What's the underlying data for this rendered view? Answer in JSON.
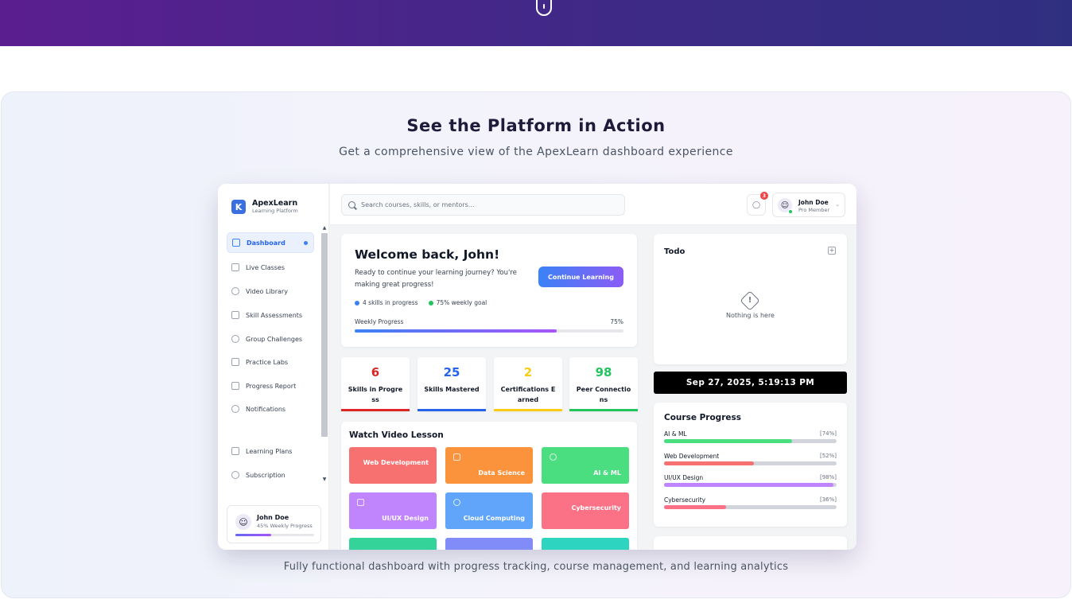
{
  "section": {
    "title": "See the Platform in Action",
    "subtitle": "Get a comprehensive view of the ApexLearn dashboard experience",
    "caption": "Fully functional dashboard with progress tracking, course management, and learning analytics"
  },
  "brand": {
    "logo": "K",
    "name": "ApexLearn",
    "tagline": "Learning Platform"
  },
  "sidebar": {
    "items": [
      {
        "label": "Dashboard",
        "icon": "home-icon",
        "active": true
      },
      {
        "label": "Live Classes",
        "icon": "video-icon"
      },
      {
        "label": "Video Library",
        "icon": "play-icon"
      },
      {
        "label": "Skill Assessments",
        "icon": "clipboard-icon"
      },
      {
        "label": "Group Challenges",
        "icon": "trophy-icon"
      },
      {
        "label": "Practice Labs",
        "icon": "lab-icon"
      },
      {
        "label": "Progress Report",
        "icon": "chart-icon"
      },
      {
        "label": "Notifications",
        "icon": "bell-icon"
      },
      {
        "label": "Learning Plans",
        "icon": "cart-icon"
      },
      {
        "label": "Subscription",
        "icon": "user-plus-icon"
      }
    ],
    "user": {
      "name": "John Doe",
      "progress_text": "45% Weekly Progress",
      "progress": 0.45
    }
  },
  "topbar": {
    "search_placeholder": "Search courses, skills, or mentors...",
    "notification_count": "3",
    "user_name": "John Doe",
    "user_role": "Pro Member"
  },
  "welcome": {
    "title": "Welcome back, John!",
    "text": "Ready to continue your learning journey? You're making great progress!",
    "cta": "Continue Learning",
    "chip1": "4 skills in progress",
    "chip2": "75% weekly goal",
    "progress_label": "Weekly Progress",
    "progress_value": "75%",
    "progress": 0.75
  },
  "stats": [
    {
      "value": "6",
      "label": "Skills in Progress",
      "color": "#dc2626"
    },
    {
      "value": "25",
      "label": "Skills Mastered",
      "color": "#2563eb"
    },
    {
      "value": "2",
      "label": "Certifications Earned",
      "color": "#facc15"
    },
    {
      "value": "98",
      "label": "Peer Connections",
      "color": "#22c55e"
    }
  ],
  "videos": {
    "title": "Watch Video Lesson",
    "tiles": [
      {
        "label": "Web Development",
        "color": "#f87171"
      },
      {
        "label": "Data Science",
        "color": "#fb923c"
      },
      {
        "label": "AI & ML",
        "color": "#4ade80"
      },
      {
        "label": "UI/UX Design",
        "color": "#c084fc"
      },
      {
        "label": "Cloud Computing",
        "color": "#60a5fa"
      },
      {
        "label": "Cybersecurity",
        "color": "#fb7185"
      }
    ]
  },
  "todo": {
    "title": "Todo",
    "empty_text": "Nothing is here"
  },
  "clock": "Sep 27, 2025, 5:19:13 PM",
  "course_progress": {
    "title": "Course Progress",
    "courses": [
      {
        "name": "AI & ML",
        "pct": "[74%]",
        "value": 0.74,
        "color": "#4ade80"
      },
      {
        "name": "Web Development",
        "pct": "[52%]",
        "value": 0.52,
        "color": "#f87171"
      },
      {
        "name": "UI/UX Design",
        "pct": "[98%]",
        "value": 0.98,
        "color": "#c084fc"
      },
      {
        "name": "Cybersecurity",
        "pct": "[36%]",
        "value": 0.36,
        "color": "#fb7185"
      }
    ]
  }
}
